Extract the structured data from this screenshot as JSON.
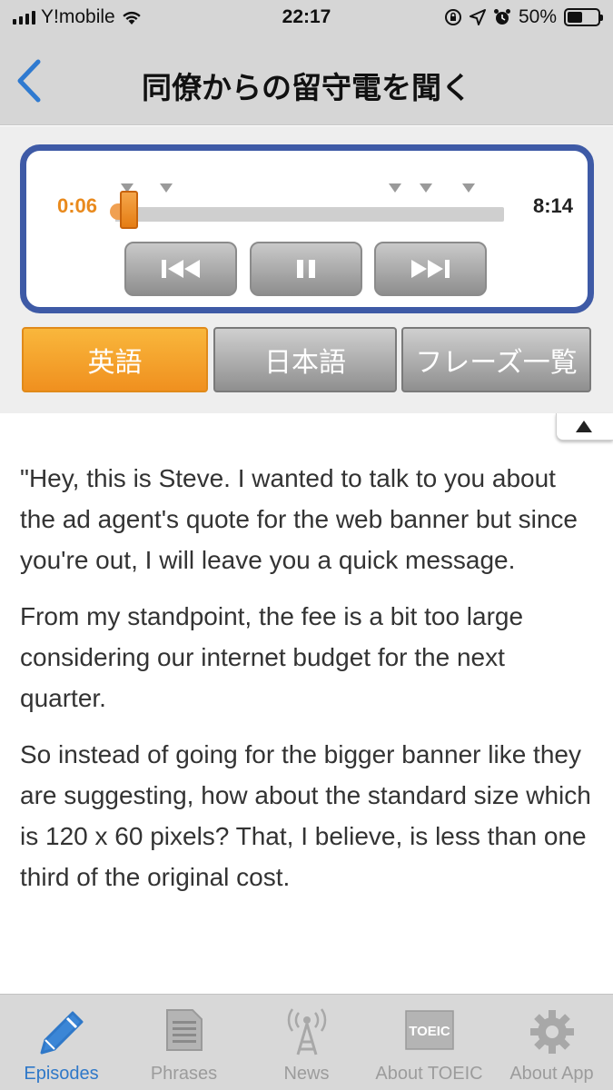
{
  "status_bar": {
    "carrier": "Y!mobile",
    "time": "22:17",
    "battery_percent": "50%",
    "battery_level": 0.5,
    "icons": [
      "signal-icon",
      "wifi-icon",
      "orientation-lock-icon",
      "location-icon",
      "alarm-icon",
      "battery-icon"
    ]
  },
  "navbar": {
    "title": "同僚からの留守電を聞く",
    "back_icon": "chevron-left-icon"
  },
  "player": {
    "current_time": "0:06",
    "total_time": "8:14",
    "progress": 0.012,
    "markers": [
      0.03,
      0.13,
      0.72,
      0.8,
      0.91
    ],
    "controls": [
      "rewind-icon",
      "pause-icon",
      "fast-forward-icon"
    ]
  },
  "tabs": [
    {
      "label": "英語",
      "active": true
    },
    {
      "label": "日本語",
      "active": false
    },
    {
      "label": "フレーズ一覧",
      "active": false
    }
  ],
  "transcript": {
    "paragraphs": [
      "\"Hey, this is Steve. I wanted to talk to you about the ad agent's quote for the web banner but since you're out, I will leave you a quick message.",
      "From my standpoint, the fee is a bit too large considering our internet budget for the next quarter.",
      "So instead of going for the bigger banner like they are suggesting, how about the standard size which is 120 x 60 pixels? That, I believe, is less than one third of the original cost."
    ]
  },
  "tabbar": {
    "items": [
      {
        "label": "Episodes",
        "icon": "pencil-icon",
        "active": true
      },
      {
        "label": "Phrases",
        "icon": "document-icon",
        "active": false
      },
      {
        "label": "News",
        "icon": "broadcast-tower-icon",
        "active": false
      },
      {
        "label": "About TOEIC",
        "icon": "toeic-logo-icon",
        "icon_text": "TOEIC",
        "active": false
      },
      {
        "label": "About App",
        "icon": "gear-icon",
        "active": false
      }
    ]
  },
  "colors": {
    "accent_orange": "#e98a1d",
    "player_border": "#3e5aa6",
    "active_tab_blue": "#2f78c8",
    "bar_gray": "#d6d6d6"
  }
}
